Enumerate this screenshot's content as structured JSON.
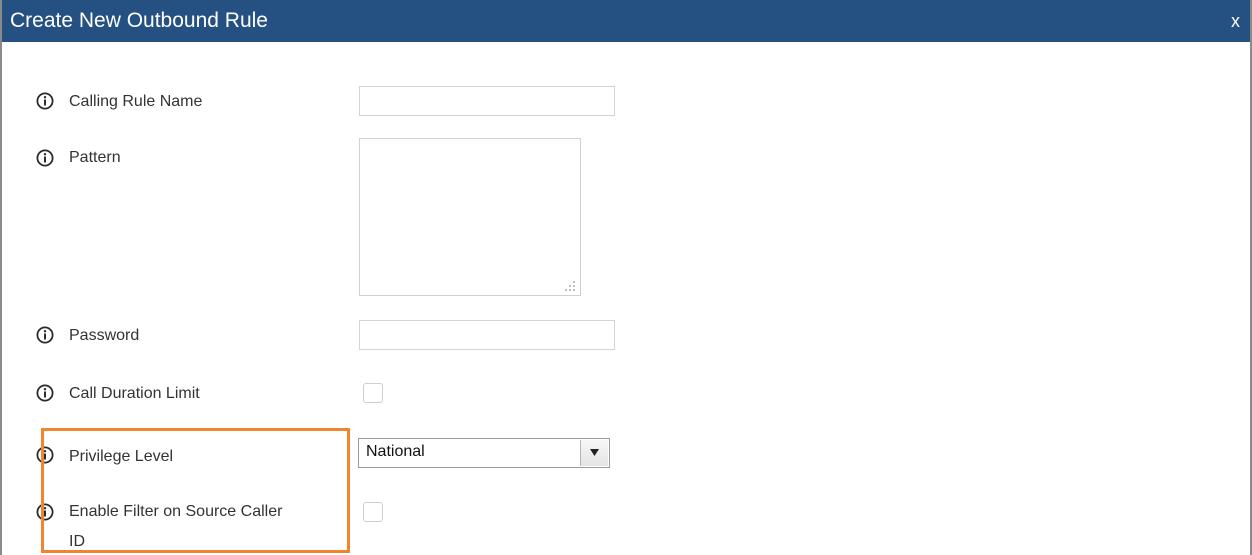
{
  "dialog": {
    "title": "Create New Outbound Rule",
    "close_label": "x"
  },
  "fields": {
    "calling_rule_name": {
      "label": "Calling Rule Name",
      "value": ""
    },
    "pattern": {
      "label": "Pattern",
      "value": ""
    },
    "password": {
      "label": "Password",
      "value": ""
    },
    "call_duration_limit": {
      "label": "Call Duration Limit",
      "checked": false
    },
    "privilege_level": {
      "label": "Privilege Level",
      "selected": "National"
    },
    "enable_filter": {
      "label_line1": "Enable Filter on Source Caller",
      "label_line2": "ID",
      "checked": false
    }
  },
  "colors": {
    "title_bar": "#245182",
    "highlight": "#f0852d",
    "info_icon": "#2b2b2b"
  },
  "icons": [
    "info-icon",
    "close-icon",
    "dropdown-arrow-icon",
    "resize-grip-icon"
  ]
}
